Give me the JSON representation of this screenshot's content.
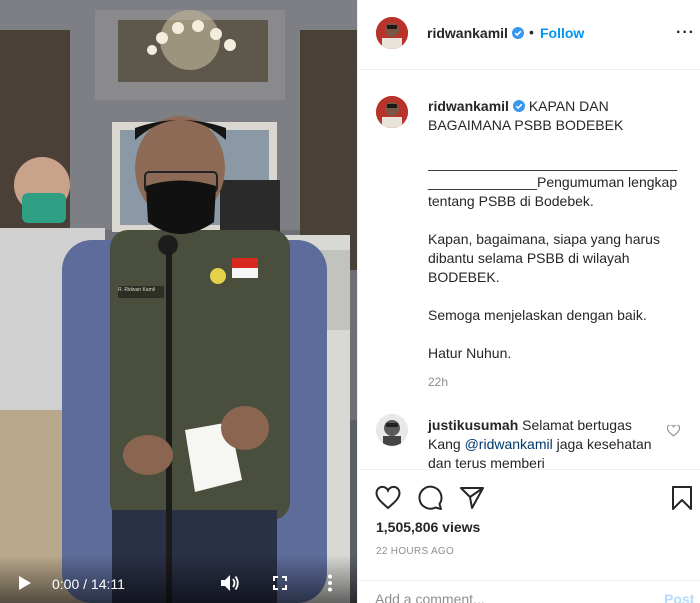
{
  "video": {
    "time_display": "0:00 / 14:11",
    "speaker_name_patch": "R. Ridwan Kamil",
    "icons": {
      "play": "play-icon",
      "volume": "volume-icon",
      "fullscreen": "fullscreen-icon",
      "more": "more-vertical-icon"
    }
  },
  "header": {
    "username": "ridwankamil",
    "separator": "•",
    "follow_label": "Follow",
    "more_label": "···"
  },
  "caption": {
    "username": "ridwankamil",
    "title": "KAPAN DAN BAGAIMANA PSBB BODEBEK",
    "line1": "________________________________",
    "line2": "______________Pengumuman lengkap tentang PSBB di Bodebek.",
    "para2": "Kapan, bagaimana, siapa yang harus dibantu selama PSBB di wilayah BODEBEK.",
    "para3": "Semoga menjelaskan dengan baik.",
    "para4": "Hatur Nuhun.",
    "time": "22h"
  },
  "comment": {
    "username": "justikusumah",
    "text_before": "Selamat bertugas Kang ",
    "mention": "@ridwankamil",
    "text_after": " jaga kesehatan dan terus memberi"
  },
  "actions": {
    "views": "1,505,806 views",
    "posted": "22 HOURS AGO",
    "comment_placeholder": "Add a comment...",
    "post_label": "Post"
  },
  "colors": {
    "accent": "#0095f6",
    "verified": "#3897f0",
    "muted": "#8e8e8e",
    "post_disabled": "#b3dbff"
  }
}
